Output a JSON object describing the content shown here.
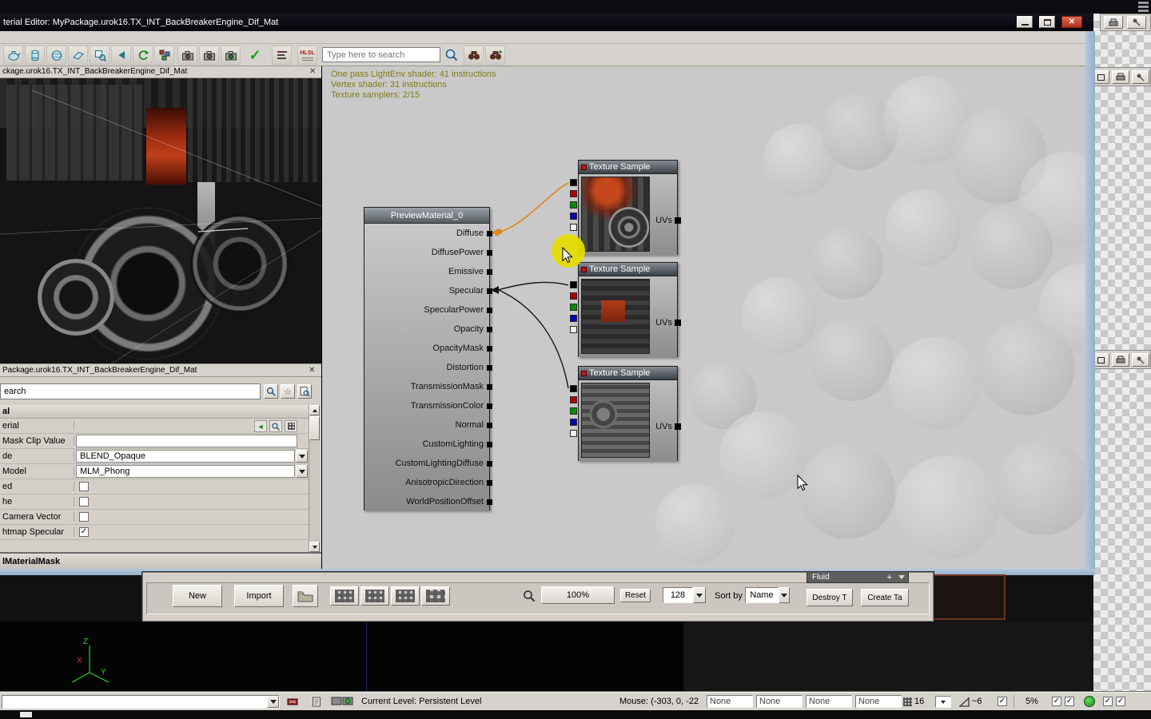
{
  "icons": {
    "close": "✕",
    "check": "✓",
    "star": "☆",
    "plus": "+",
    "use_arrow": "◄"
  },
  "titlebar": {
    "title": "terial Editor: MyPackage.urok16.TX_INT_BackBreakerEngine_Dif_Mat"
  },
  "toolbar": {
    "search_placeholder": "Type here to search",
    "hlsl_label": "HLSL"
  },
  "preview_panel": {
    "title": "ckage.urok16.TX_INT_BackBreakerEngine_Dif_Mat"
  },
  "properties_panel": {
    "title": "Package.urok16.TX_INT_BackBreakerEngine_Dif_Mat",
    "search_value": "earch",
    "category": "al",
    "rows": {
      "material_label": "erial",
      "mask_clip_label": "Mask Clip Value",
      "blend_mode_label": "de",
      "blend_mode_value": "BLEND_Opaque",
      "lighting_model_label": "Model",
      "lighting_model_value": "MLM_Phong",
      "cb1_label": "ed",
      "cb2_label": "he",
      "cb3_label": "Camera Vector",
      "cb4_label": "htmap Specular"
    },
    "footer": "lMaterialMask"
  },
  "graph": {
    "info_lines": [
      "One pass LightEnv shader: 41 instructions",
      "Vertex shader: 31 instructions",
      "Texture samplers: 2/15"
    ],
    "material_node": {
      "title": "PreviewMaterial_0",
      "inputs": [
        "Diffuse",
        "DiffusePower",
        "Emissive",
        "Specular",
        "SpecularPower",
        "Opacity",
        "OpacityMask",
        "Distortion",
        "TransmissionMask",
        "TransmissionColor",
        "Normal",
        "CustomLighting",
        "CustomLightingDiffuse",
        "AnisotropicDirection",
        "WorldPositionOffset"
      ]
    },
    "texture_nodes": [
      {
        "title": "Texture Sample",
        "uv_label": "UVs"
      },
      {
        "title": "Texture Sample",
        "uv_label": "UVs"
      },
      {
        "title": "Texture Sample",
        "uv_label": "UVs"
      }
    ]
  },
  "content_browser": {
    "new_label": "New",
    "import_label": "Import",
    "zoom_value": "100%",
    "reset_label": "Reset",
    "thumb_size": "128",
    "sort_label": "Sort by",
    "sort_value": "Name",
    "destroy_label": "Destroy T",
    "create_label": "Create Ta",
    "fluid_label": "Fluid"
  },
  "status_bar": {
    "current_level": "Current Level:  Persistent Level",
    "mouse": "Mouse: (-303, 0, -22",
    "none1": "None",
    "none2": "None",
    "none3": "None",
    "none4": "None",
    "grid_size": "16",
    "angle": "~6",
    "percent": "5%"
  },
  "colors": {
    "wire_orange": "#e0881f",
    "highlight_yellow": "#e6dc00",
    "close_red": "#c23b2a"
  }
}
